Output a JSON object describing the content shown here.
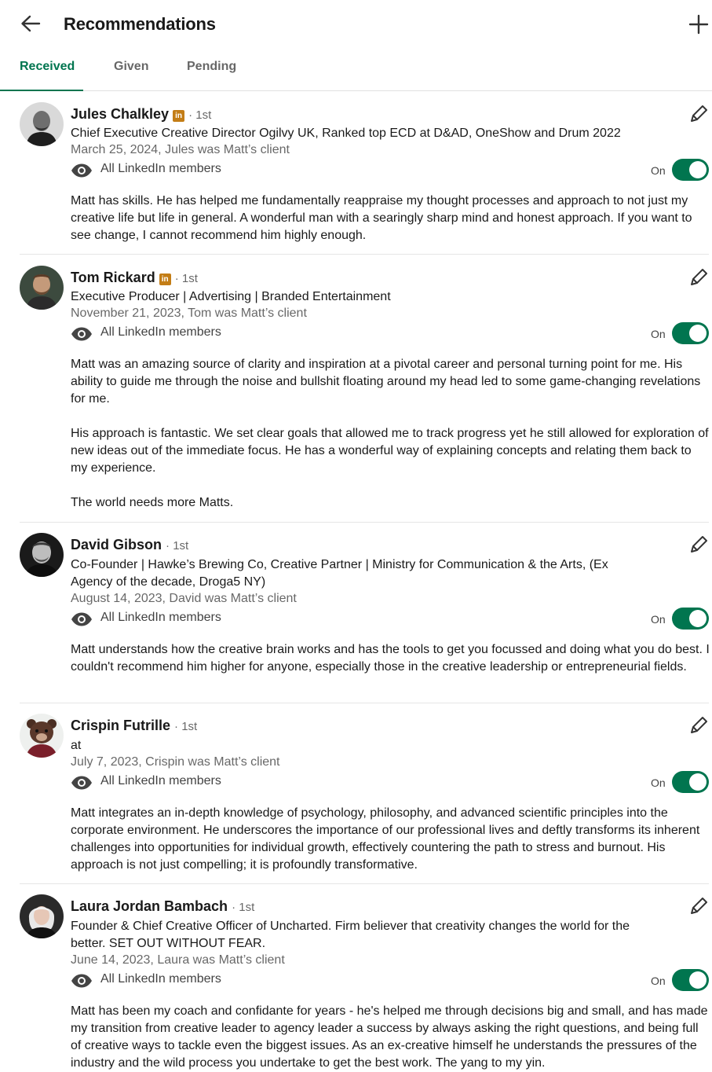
{
  "header": {
    "title": "Recommendations",
    "back_icon": "arrow-left-icon",
    "add_icon": "plus-icon"
  },
  "tabs": [
    {
      "label": "Received",
      "active": true
    },
    {
      "label": "Given",
      "active": false
    },
    {
      "label": "Pending",
      "active": false
    }
  ],
  "colors": {
    "accent": "#01754f",
    "linkedin_badge": "#c37d16",
    "secondary_text": "rgba(0,0,0,0.6)"
  },
  "recommendations": [
    {
      "name": "Jules Chalkley",
      "badge": "in",
      "degree": "· 1st",
      "headline": "Chief Executive Creative Director Ogilvy UK, Ranked top ECD at D&AD, OneShow and Drum 2022",
      "meta": "March 25, 2024, Jules was Matt’s client",
      "visibility": "All LinkedIn members",
      "toggle_label": "On",
      "body": [
        "Matt has skills. He has helped me fundamentally reappraise my thought processes and approach to not just my creative life but life in general. A wonderful man with a searingly sharp mind and honest approach. If you want to see change, I cannot recommend him highly enough."
      ]
    },
    {
      "name": "Tom Rickard",
      "badge": "in",
      "degree": "· 1st",
      "headline": "Executive Producer | Advertising | Branded Entertainment",
      "meta": "November 21, 2023, Tom was Matt’s client",
      "visibility": "All LinkedIn members",
      "toggle_label": "On",
      "body": [
        "Matt was an amazing source of clarity and inspiration at a pivotal career and personal turning point for me. His ability to guide me through the noise and bullshit floating around my head led to some game-changing revelations for me.",
        "His approach is fantastic. We set clear goals that allowed me to track progress yet he still allowed for exploration of new ideas out of the immediate focus. He has a wonderful way of explaining concepts and relating them back to my experience.",
        "The world needs more Matts."
      ]
    },
    {
      "name": "David Gibson",
      "badge": "",
      "degree": "· 1st",
      "headline": "Co-Founder | Hawke’s Brewing Co, Creative Partner | Ministry for Communication & the Arts, (Ex Agency of the decade, Droga5 NY)",
      "meta": "August 14, 2023, David was Matt’s client",
      "visibility": "All LinkedIn members",
      "toggle_label": "On",
      "body": [
        "Matt understands how the creative brain works and has the tools to get you focussed and doing what you do best. I couldn't recommend him higher for anyone, especially those in the creative leadership or entrepreneurial fields."
      ]
    },
    {
      "name": "Crispin Futrille",
      "badge": "",
      "degree": "· 1st",
      "headline": "at",
      "meta": "July 7, 2023, Crispin was Matt’s client",
      "visibility": "All LinkedIn members",
      "toggle_label": "On",
      "body": [
        "Matt integrates an in-depth knowledge of psychology, philosophy, and advanced scientific principles into the corporate environment. He underscores the importance of our professional lives and deftly transforms its inherent challenges into opportunities for individual growth, effectively countering the path to stress and burnout. His approach is not just compelling; it is profoundly transformative."
      ]
    },
    {
      "name": "Laura Jordan Bambach",
      "badge": "",
      "degree": "· 1st",
      "headline": "Founder & Chief Creative Officer of Uncharted. Firm believer that creativity changes the world for the better. SET OUT WITHOUT FEAR.",
      "meta": "June 14, 2023, Laura was Matt’s client",
      "visibility": "All LinkedIn members",
      "toggle_label": "On",
      "body": [
        "Matt has been my coach and confidante for years - he's helped me through decisions big and small, and has made my transition from creative leader to agency leader a success by always asking the right questions, and being full of creative ways to tackle even the biggest issues. As an ex-creative himself he understands the pressures of the industry and the wild process you undertake to get the best work. The yang to my yin."
      ]
    }
  ]
}
